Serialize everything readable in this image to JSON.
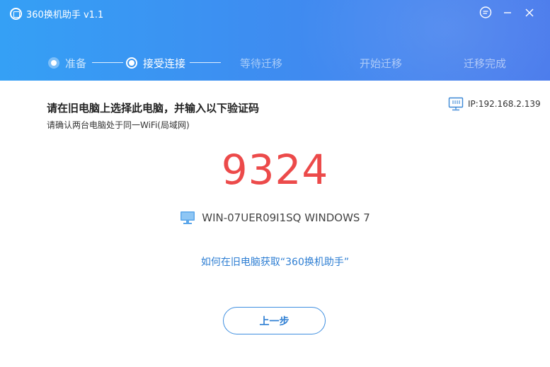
{
  "window": {
    "title": "360换机助手 v1.1"
  },
  "steps": [
    {
      "label": "准备",
      "state": "done"
    },
    {
      "label": "接受连接",
      "state": "active"
    },
    {
      "label": "等待迁移",
      "state": "pending"
    },
    {
      "label": "开始迁移",
      "state": "pending"
    },
    {
      "label": "迁移完成",
      "state": "pending"
    }
  ],
  "main": {
    "instruction": "请在旧电脑上选择此电脑，并输入以下验证码",
    "sub_instruction": "请确认两台电脑处于同一WiFi(局域网)",
    "ip": "IP:192.168.2.139",
    "code": "9324",
    "device_name": "WIN-07UER09I1SQ WINDOWS 7",
    "help_link": "如何在旧电脑获取“360换机助手”",
    "back_button": "上一步"
  },
  "colors": {
    "header_start": "#35a0f5",
    "header_end": "#4a7bec",
    "code": "#ec4a4a",
    "link": "#2f7fd3"
  },
  "icons": [
    "app-logo-icon",
    "feedback-icon",
    "minimize-icon",
    "close-icon",
    "network-icon",
    "monitor-icon"
  ]
}
